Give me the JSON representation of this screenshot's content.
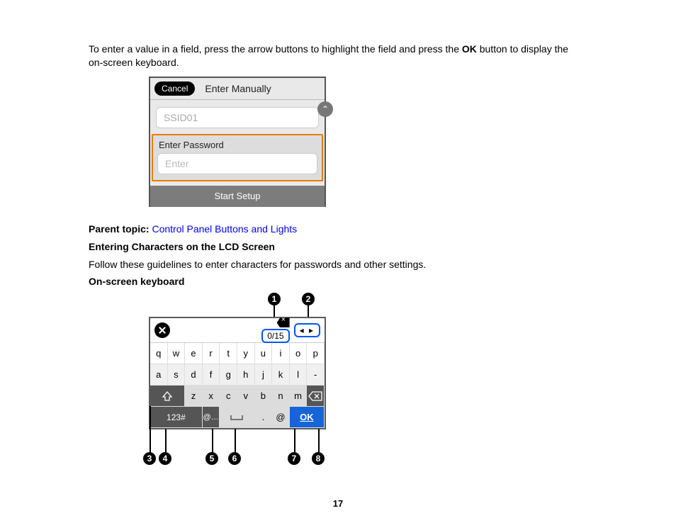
{
  "intro": {
    "text_before_bold": "To enter a value in a field, press the arrow buttons to highlight the field and press the ",
    "bold": "OK",
    "text_after_bold": " button to display the on-screen keyboard."
  },
  "lcd1": {
    "cancel": "Cancel",
    "title": "Enter Manually",
    "ssid_placeholder": "SSID01",
    "pw_label": "Enter Password",
    "pw_placeholder": "Enter",
    "start": "Start Setup",
    "scroll_glyph": "⌃"
  },
  "parent_topic_label": "Parent topic:",
  "parent_topic_link": "Control Panel Buttons and Lights",
  "section_heading": "Entering Characters on the LCD Screen",
  "section_intro": "Follow these guidelines to enter characters for passwords and other settings.",
  "kb_heading": "On-screen keyboard",
  "keyboard": {
    "counter": "0/15",
    "arrows": "◂  ▸",
    "row1": [
      "q",
      "w",
      "e",
      "r",
      "t",
      "y",
      "u",
      "i",
      "o",
      "p"
    ],
    "row2": [
      "a",
      "s",
      "d",
      "f",
      "g",
      "h",
      "j",
      "k",
      "l",
      "-"
    ],
    "row3_shift": "⇧",
    "row3_keys": [
      "z",
      "x",
      "c",
      "v",
      "b",
      "n",
      "m"
    ],
    "row4_mode": "123#",
    "row4_at_ellipsis": "@…",
    "row4_space": "␣",
    "row4_dot": ".",
    "row4_at": "@",
    "row4_ok": "OK",
    "callouts": [
      "1",
      "2",
      "3",
      "4",
      "5",
      "6",
      "7",
      "8"
    ]
  },
  "page_number": "17"
}
